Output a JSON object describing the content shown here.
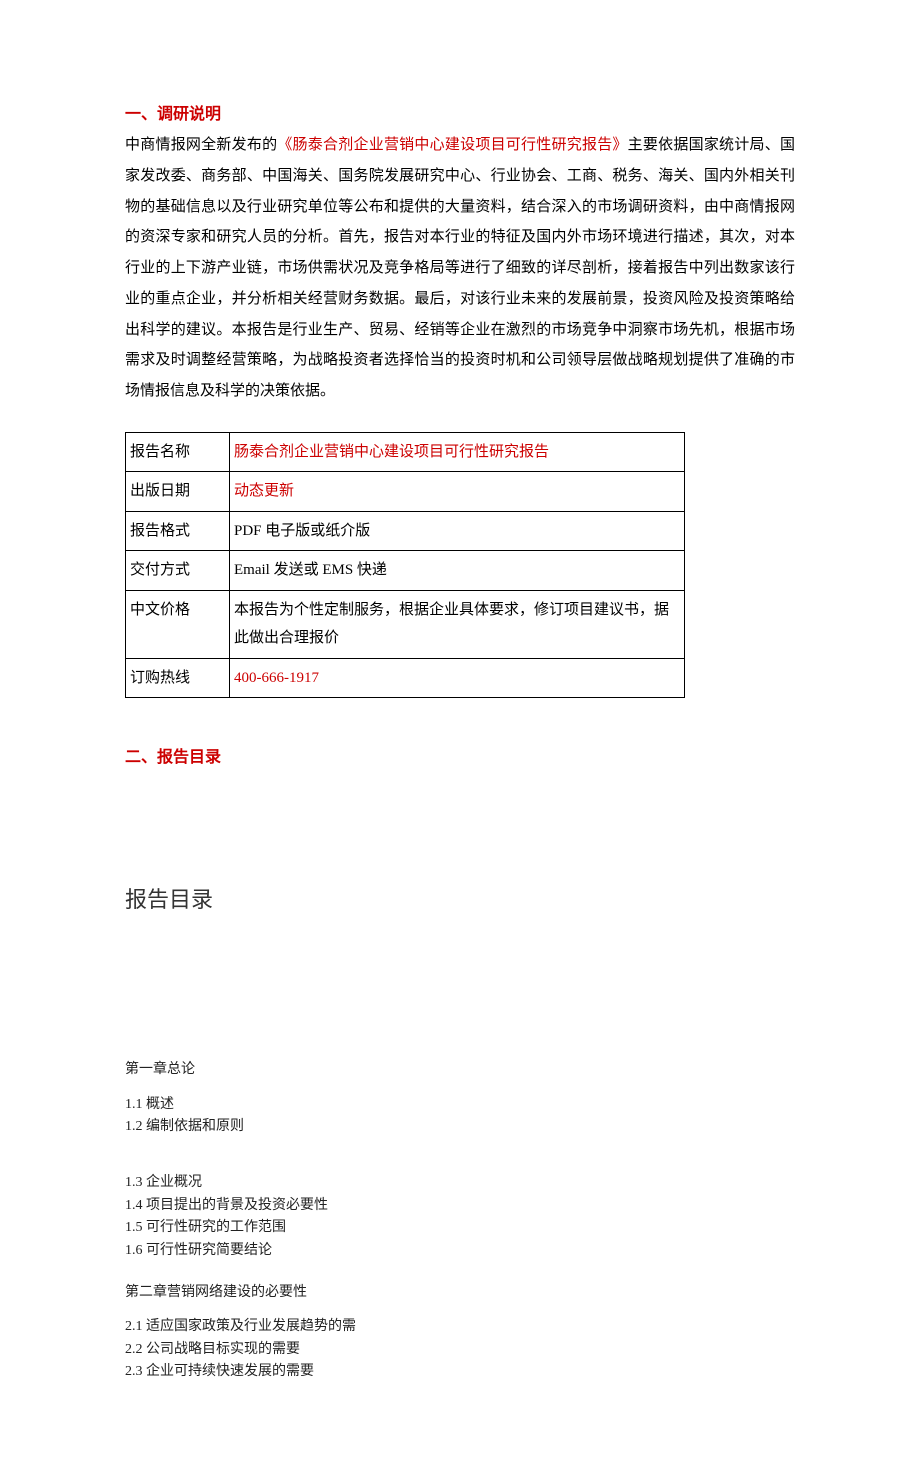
{
  "section1": {
    "heading": "一、调研说明",
    "paragraph_pre": "中商情报网全新发布的",
    "paragraph_red": "《肠泰合剂企业营销中心建设项目可行性研究报告》",
    "paragraph_post": "主要依据国家统计局、国家发改委、商务部、中国海关、国务院发展研究中心、行业协会、工商、税务、海关、国内外相关刊物的基础信息以及行业研究单位等公布和提供的大量资料，结合深入的市场调研资料，由中商情报网的资深专家和研究人员的分析。首先，报告对本行业的特征及国内外市场环境进行描述，其次，对本行业的上下游产业链，市场供需状况及竞争格局等进行了细致的详尽剖析，接着报告中列出数家该行业的重点企业，并分析相关经营财务数据。最后，对该行业未来的发展前景，投资风险及投资策略给出科学的建议。本报告是行业生产、贸易、经销等企业在激烈的市场竞争中洞察市场先机，根据市场需求及时调整经营策略，为战略投资者选择恰当的投资时机和公司领导层做战略规划提供了准确的市场情报信息及科学的决策依据。"
  },
  "table": {
    "rows": [
      {
        "label": "报告名称",
        "value": "肠泰合剂企业营销中心建设项目可行性研究报告",
        "red": true
      },
      {
        "label": "出版日期",
        "value": "动态更新",
        "red": true
      },
      {
        "label": "报告格式",
        "value": "PDF 电子版或纸介版",
        "red": false
      },
      {
        "label": "交付方式",
        "value": "Email 发送或 EMS 快递",
        "red": false
      },
      {
        "label": "中文价格",
        "value": "本报告为个性定制服务，根据企业具体要求，修订项目建议书，据此做出合理报价",
        "red": false
      },
      {
        "label": "订购热线",
        "value": "400-666-1917",
        "red": true
      }
    ]
  },
  "section2": {
    "heading": "二、报告目录",
    "toc_title": "报告目录"
  },
  "toc": {
    "chapter1": {
      "title": "第一章总论",
      "group1": [
        "1.1 概述",
        "1.2 编制依据和原则"
      ],
      "group2": [
        "1.3 企业概况",
        "1.4 项目提出的背景及投资必要性",
        "1.5 可行性研究的工作范围",
        "1.6 可行性研究简要结论"
      ]
    },
    "chapter2": {
      "title": "第二章营销网络建设的必要性",
      "items": [
        "2.1 适应国家政策及行业发展趋势的需",
        "2.2  公司战略目标实现的需要",
        "2.3 企业可持续快速发展的需要"
      ]
    }
  }
}
